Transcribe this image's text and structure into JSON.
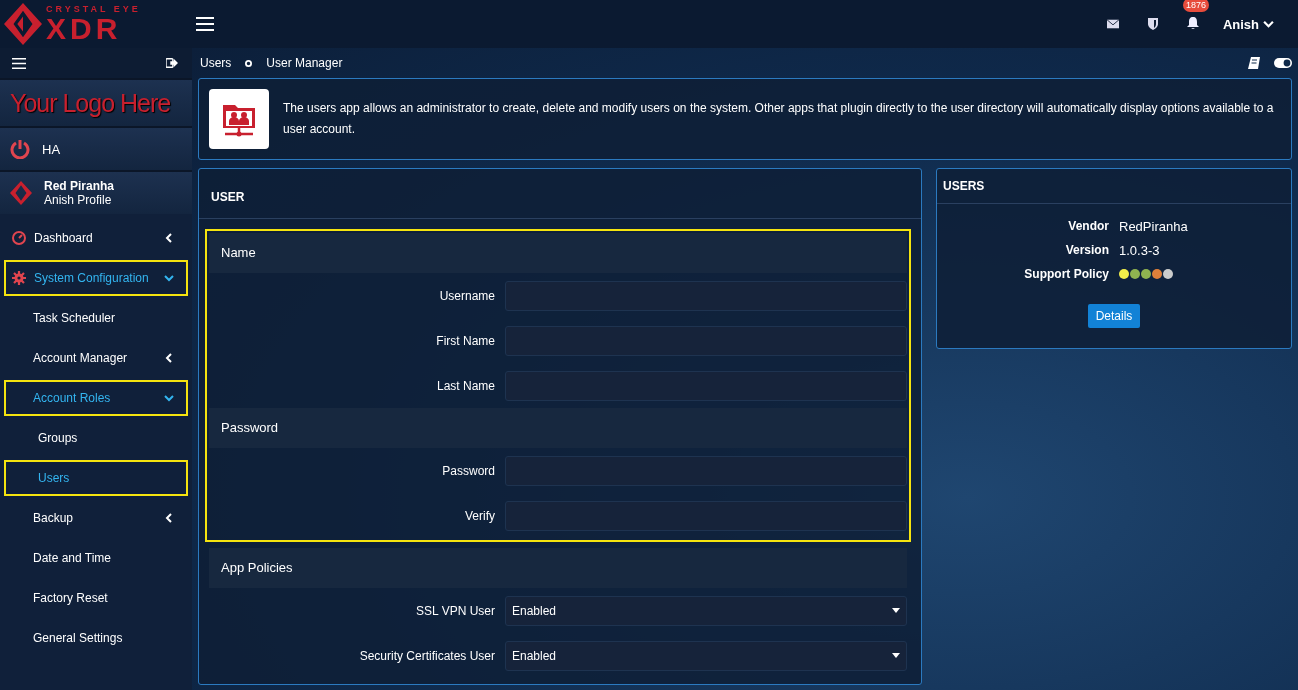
{
  "brand": {
    "tagline": "CRYSTAL EYE",
    "name": "XDR"
  },
  "topbar": {
    "notifications": "1876",
    "user": "Anish"
  },
  "sidebar": {
    "custom_logo": "Your Logo Here",
    "ha": "HA",
    "profile": {
      "name": "Red Piranha",
      "subtitle": "Anish Profile"
    },
    "items": [
      {
        "label": "Dashboard",
        "kind": "gauge",
        "selected": false,
        "highlighted": false,
        "expanded": false
      },
      {
        "label": "System Configuration",
        "kind": "gear",
        "selected": true,
        "highlighted": true,
        "expanded": true,
        "children": [
          {
            "label": "Task Scheduler",
            "selected": false,
            "highlighted": false
          },
          {
            "label": "Account Manager",
            "selected": false,
            "highlighted": false,
            "expanded": false
          },
          {
            "label": "Account Roles",
            "selected": true,
            "highlighted": true,
            "expanded": true,
            "children": [
              {
                "label": "Groups",
                "selected": false,
                "highlighted": false
              },
              {
                "label": "Users",
                "selected": true,
                "highlighted": true
              }
            ]
          },
          {
            "label": "Backup",
            "selected": false,
            "highlighted": false,
            "expanded": false
          },
          {
            "label": "Date and Time",
            "selected": false,
            "highlighted": false
          },
          {
            "label": "Factory Reset",
            "selected": false,
            "highlighted": false
          },
          {
            "label": "General Settings",
            "selected": false,
            "highlighted": false
          }
        ]
      }
    ]
  },
  "breadcrumb": [
    "Users",
    "User Manager"
  ],
  "intro": "The users app allows an administrator to create, delete and modify users on the system. Other apps that plugin directly to the user directory will automatically display options available to a user account.",
  "user_panel": {
    "title": "USER",
    "groups": [
      {
        "highlighted": true,
        "sections": [
          {
            "title": "Name",
            "fields": [
              {
                "label": "Username",
                "kind": "text"
              },
              {
                "label": "First Name",
                "kind": "text"
              },
              {
                "label": "Last Name",
                "kind": "text"
              }
            ]
          },
          {
            "title": "Password",
            "fields": [
              {
                "label": "Password",
                "kind": "text"
              },
              {
                "label": "Verify",
                "kind": "text"
              }
            ]
          }
        ]
      },
      {
        "highlighted": false,
        "sections": [
          {
            "title": "App Policies",
            "fields": [
              {
                "label": "SSL VPN User",
                "kind": "select",
                "value": "Enabled"
              },
              {
                "label": "Security Certificates User",
                "kind": "select",
                "value": "Enabled"
              }
            ]
          }
        ]
      }
    ]
  },
  "info_panel": {
    "title": "USERS",
    "rows": [
      {
        "label": "Vendor",
        "value": "RedPiranha"
      },
      {
        "label": "Version",
        "value": "1.0.3-3"
      }
    ],
    "support_label": "Support Policy",
    "support_dots": [
      {
        "color": "#f2ef4a"
      },
      {
        "color": "#8fb350"
      },
      {
        "color": "#8fb350"
      },
      {
        "color": "#e0803a"
      },
      {
        "color": "#cccccc"
      }
    ],
    "button": "Details"
  }
}
